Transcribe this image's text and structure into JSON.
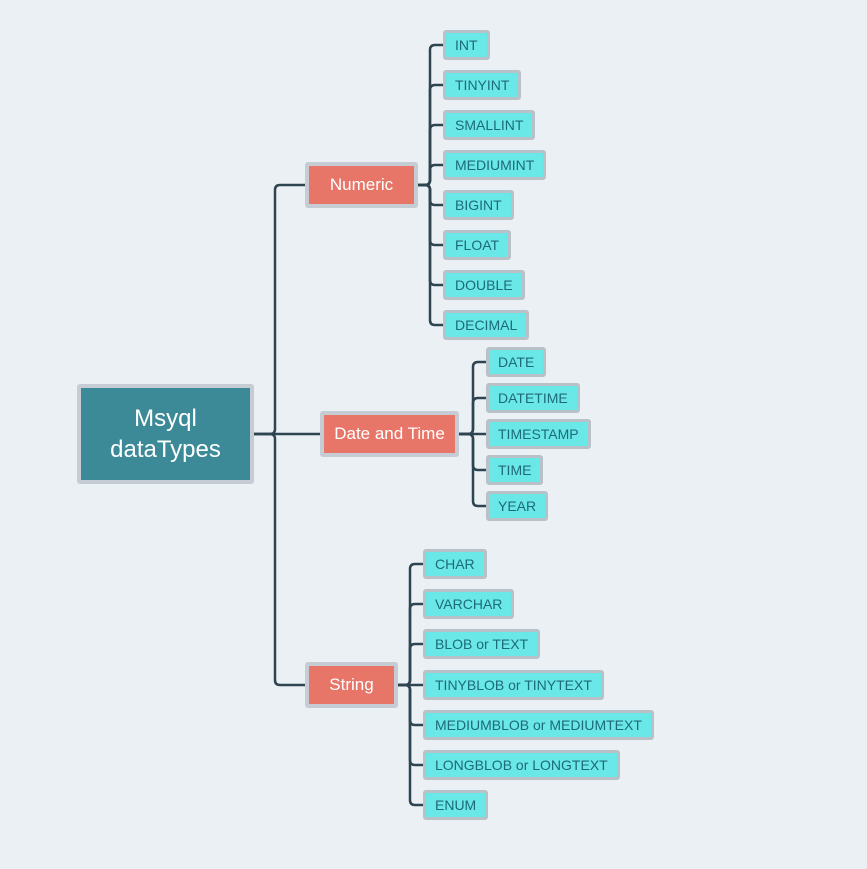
{
  "root": {
    "label": "Msyql dataTypes"
  },
  "categories": [
    {
      "key": "numeric",
      "label": "Numeric",
      "leaves": [
        "INT",
        "TINYINT",
        "SMALLINT",
        "MEDIUMINT",
        "BIGINT",
        "FLOAT",
        "DOUBLE",
        "DECIMAL"
      ]
    },
    {
      "key": "datetime",
      "label": "Date and Time",
      "leaves": [
        "DATE",
        "DATETIME",
        "TIMESTAMP",
        "TIME",
        "YEAR"
      ]
    },
    {
      "key": "string",
      "label": "String",
      "leaves": [
        "CHAR",
        "VARCHAR",
        "BLOB or TEXT",
        "TINYBLOB or TINYTEXT",
        "MEDIUMBLOB or MEDIUMTEXT",
        "LONGBLOB or LONGTEXT",
        "ENUM"
      ]
    }
  ],
  "colors": {
    "background": "#ebf0f5",
    "root_fill": "#3c8a98",
    "category_fill": "#e87668",
    "leaf_fill": "#6ae8e8",
    "border": "#c6ccd3",
    "connector": "#2e4451"
  }
}
